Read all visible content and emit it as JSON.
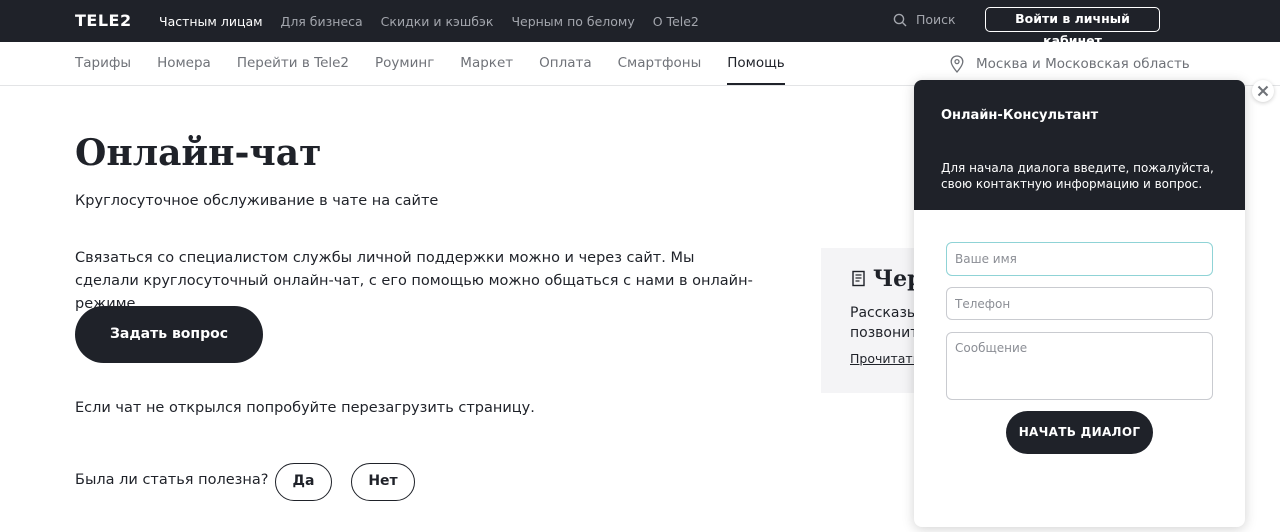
{
  "brand": {
    "logo": "TELE2",
    "dark": "#1f2229",
    "muted": "#a3a6ad"
  },
  "topnav": {
    "items": [
      {
        "label": "Частным лицам",
        "active": true
      },
      {
        "label": "Для бизнеса"
      },
      {
        "label": "Скидки и кэшбэк"
      },
      {
        "label": "Черным по белому"
      },
      {
        "label": "О Tele2"
      }
    ],
    "search_label": "Поиск",
    "search_icon": "search-icon",
    "login_label": "Войти в личный кабинет"
  },
  "subnav": {
    "items": [
      {
        "label": "Тарифы"
      },
      {
        "label": "Номера"
      },
      {
        "label": "Перейти в Tele2"
      },
      {
        "label": "Роуминг"
      },
      {
        "label": "Маркет"
      },
      {
        "label": "Оплата"
      },
      {
        "label": "Смартфоны"
      },
      {
        "label": "Помощь",
        "active": true
      }
    ],
    "region": "Москва и Московская область",
    "region_icon": "location-pin-icon"
  },
  "main": {
    "title": "Онлайн-чат",
    "subtitle": "Круглосуточное обслуживание в чате на сайте",
    "body_line1": "Связаться со специалистом службы личной поддержки можно и через сайт. Мы",
    "body_line2": "сделали круглосуточный онлайн-чат, с его помощью можно общаться с нами в онлайн-режиме.",
    "ask_button": "Задать вопрос",
    "reload_text": "Если чат не открылся попробуйте перезагрузить страницу.",
    "helpful_question": "Была ли статья полезна?",
    "yes": "Да",
    "no": "Нет"
  },
  "side_card": {
    "icon": "document-icon",
    "title": "Чер",
    "line1": "Рассказы",
    "line2": "позвонит",
    "link": "Прочитать"
  },
  "chat": {
    "title": "Онлайн-Консультант",
    "description": "Для начала диалога введите, пожалуйста, свою контактную информацию и вопрос.",
    "name_placeholder": "Ваше имя",
    "phone_placeholder": "Телефон",
    "message_placeholder": "Сообщение",
    "start_button": "НАЧАТЬ ДИАЛОГ",
    "close_icon": "close-icon"
  }
}
